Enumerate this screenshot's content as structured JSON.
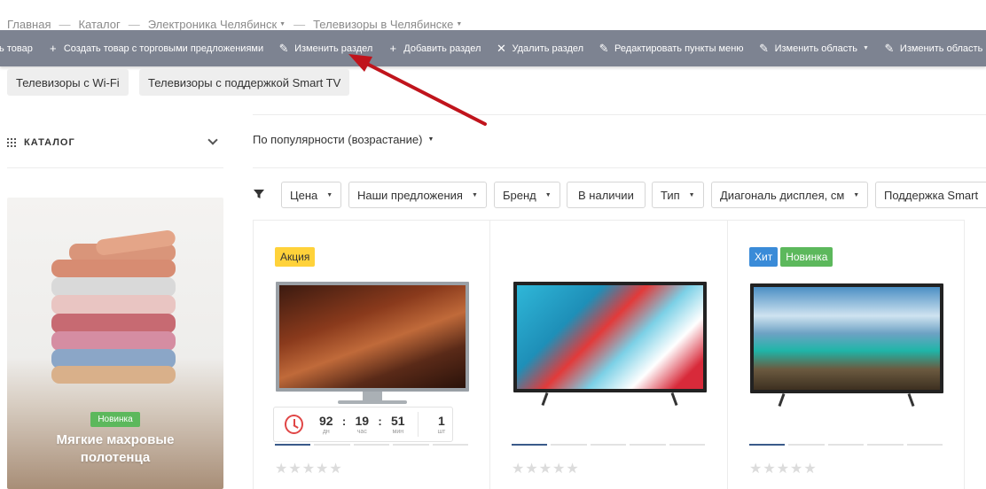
{
  "breadcrumb": [
    {
      "label": "Главная",
      "dropdown": false
    },
    {
      "label": "Каталог",
      "dropdown": false
    },
    {
      "label": "Электроника Челябинск",
      "dropdown": true
    },
    {
      "label": "Телевизоры в Челябинске",
      "dropdown": true
    }
  ],
  "breadcrumb_sep": "—",
  "admin_bar": {
    "items": [
      {
        "icon": "plus-icon",
        "glyph": "+",
        "label": "ть товар"
      },
      {
        "icon": "plus-icon",
        "glyph": "+",
        "label": "Создать товар с торговыми предложениями"
      },
      {
        "icon": "pencil-icon",
        "glyph": "✎",
        "label": "Изменить раздел"
      },
      {
        "icon": "plus-icon",
        "glyph": "+",
        "label": "Добавить раздел"
      },
      {
        "icon": "close-icon",
        "glyph": "✕",
        "label": "Удалить раздел"
      },
      {
        "icon": "pencil-icon",
        "glyph": "✎",
        "label": "Редактировать пункты меню"
      },
      {
        "icon": "pencil-icon",
        "glyph": "✎",
        "label": "Изменить область"
      },
      {
        "icon": "pencil-icon",
        "glyph": "✎",
        "label": "Изменить область"
      }
    ]
  },
  "tags": [
    "Телевизоры с Wi-Fi",
    "Телевизоры с поддержкой Smart TV"
  ],
  "sidebar": {
    "catalog_title": "КАТАЛОГ",
    "banner": {
      "badge": "Новинка",
      "title_line1": "Мягкие махровые",
      "title_line2": "полотенца"
    }
  },
  "sort": {
    "label": "По популярности (возрастание)"
  },
  "filters": [
    {
      "label": "Цена",
      "dropdown": true
    },
    {
      "label": "Наши предложения",
      "dropdown": true
    },
    {
      "label": "Бренд",
      "dropdown": true
    },
    {
      "label": "В наличии",
      "dropdown": false
    },
    {
      "label": "Тип",
      "dropdown": true
    },
    {
      "label": "Диагональ дисплея, см",
      "dropdown": true
    },
    {
      "label": "Поддержка Smart",
      "dropdown": false
    }
  ],
  "products": [
    {
      "badges": [
        {
          "label": "Акция",
          "kind": "sale"
        }
      ]
    },
    {
      "badges": []
    },
    {
      "badges": [
        {
          "label": "Хит",
          "kind": "hit"
        },
        {
          "label": "Новинка",
          "kind": "new"
        }
      ]
    }
  ],
  "countdown": {
    "days": "92",
    "days_label": "дн",
    "hours": "19",
    "hours_label": "час",
    "minutes": "51",
    "minutes_label": "мин",
    "qty": "1",
    "qty_label": "шт"
  },
  "rating_stars": "★★★★★",
  "colors": {
    "admin_bar": "#7d8391",
    "sale": "#ffd23a",
    "hit": "#3a8bd8",
    "new": "#5cb85c",
    "arrow": "#c0141c"
  }
}
